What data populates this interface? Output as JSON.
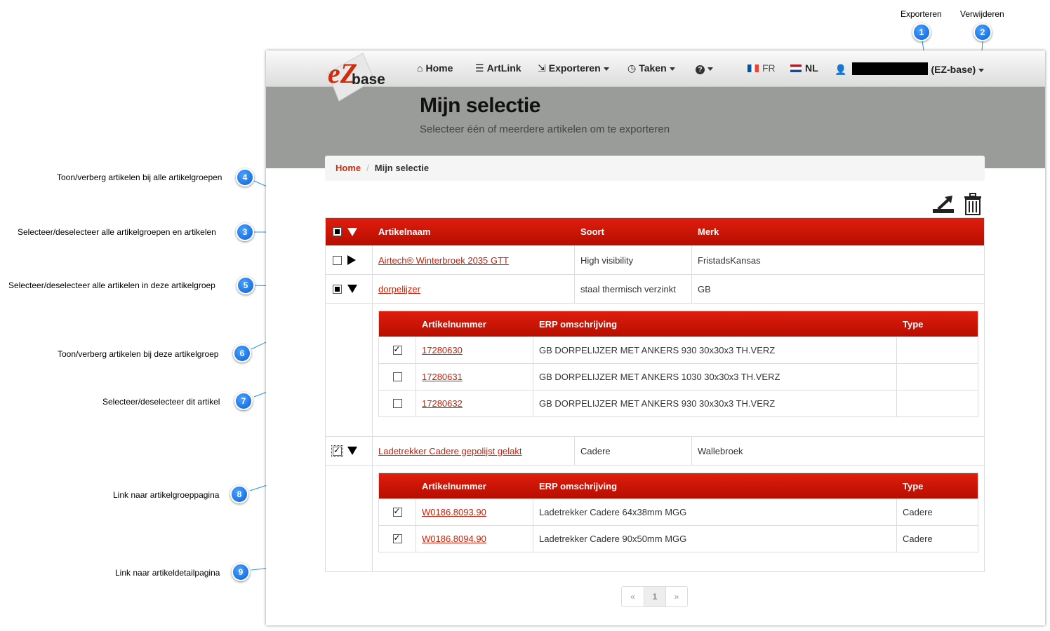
{
  "annotations": [
    {
      "num": "1",
      "label": "Exporteren"
    },
    {
      "num": "2",
      "label": "Verwijderen"
    },
    {
      "num": "3",
      "label": "Selecteer/deselecteer alle artikelgroepen en artikelen"
    },
    {
      "num": "4",
      "label": "Toon/verberg artikelen bij alle artikelgroepen"
    },
    {
      "num": "5",
      "label": "Selecteer/deselecteer alle artikelen in deze artikelgroep"
    },
    {
      "num": "6",
      "label": "Toon/verberg artikelen bij deze artikelgroep"
    },
    {
      "num": "7",
      "label": "Selecteer/deselecteer dit artikel"
    },
    {
      "num": "8",
      "label": "Link naar artikelgroeppagina"
    },
    {
      "num": "9",
      "label": "Link naar artikeldetailpagina"
    }
  ],
  "nav": {
    "logo_letters": "eZ",
    "logo_word": "base",
    "home": "Home",
    "artlink": "ArtLink",
    "exporteren": "Exporteren",
    "taken": "Taken",
    "help_icon": "?",
    "lang_fr": "FR",
    "lang_nl": "NL",
    "user_suffix": "(EZ-base)"
  },
  "header": {
    "title": "Mijn selectie",
    "subtitle": "Selecteer één of meerdere artikelen om te exporteren"
  },
  "breadcrumb": {
    "home": "Home",
    "current": "Mijn selectie"
  },
  "table": {
    "headers": [
      "Artikelnaam",
      "Soort",
      "Merk"
    ],
    "groups": [
      {
        "name": "Airtech® Winterbroek 2035 GTT",
        "soort": "High visibility",
        "merk": "FristadsKansas"
      },
      {
        "name": "dorpelijzer",
        "soort": "staal thermisch verzinkt",
        "merk": "GB"
      },
      {
        "name": "Ladetrekker Cadere gepolijst gelakt",
        "soort": "Cadere",
        "merk": "Wallebroek"
      }
    ],
    "sub_headers": [
      "Artikelnummer",
      "ERP omschrijving",
      "Type"
    ],
    "group2_articles": [
      {
        "nummer": "17280630",
        "erp": "GB DORPELIJZER MET ANKERS 930 30x30x3 TH.VERZ",
        "type": ""
      },
      {
        "nummer": "17280631",
        "erp": "GB DORPELIJZER MET ANKERS 1030 30x30x3 TH.VERZ",
        "type": ""
      },
      {
        "nummer": "17280632",
        "erp": "GB DORPELIJZER MET ANKERS 930 30x30x3 TH.VERZ",
        "type": ""
      }
    ],
    "group3_articles": [
      {
        "nummer": "W0186.8093.90",
        "erp": "Ladetrekker Cadere 64x38mm MGG",
        "type": "Cadere"
      },
      {
        "nummer": "W0186.8094.90",
        "erp": "Ladetrekker Cadere 90x50mm MGG",
        "type": "Cadere"
      }
    ]
  },
  "pagination": {
    "prev": "«",
    "current": "1",
    "next": "»"
  },
  "colors": {
    "brand_red": "#d42b0a",
    "header_red": "#c8150a",
    "bubble_blue": "#0a6fe6"
  }
}
